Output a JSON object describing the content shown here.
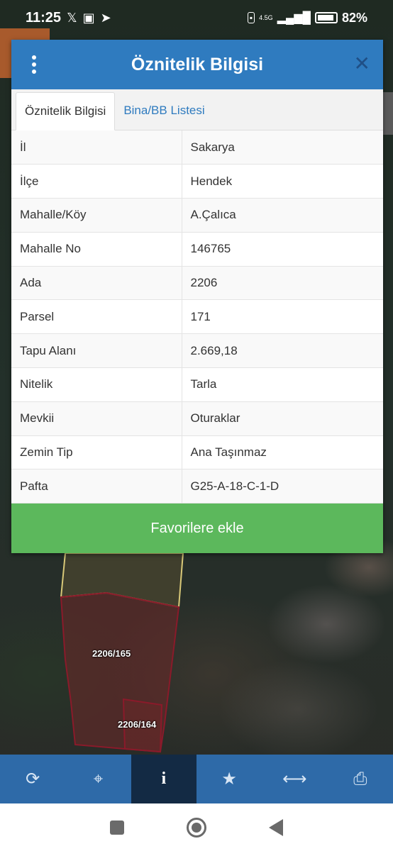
{
  "status_bar": {
    "time": "11:25",
    "left_icons": [
      "x-icon",
      "image-icon",
      "telegram-icon"
    ],
    "network": "4.5G",
    "battery_percent": "82%"
  },
  "dialog": {
    "title": "Öznitelik Bilgisi",
    "tabs": [
      {
        "label": "Öznitelik Bilgisi",
        "active": true
      },
      {
        "label": "Bina/BB Listesi",
        "active": false
      }
    ],
    "rows": [
      {
        "key": "İl",
        "value": "Sakarya"
      },
      {
        "key": "İlçe",
        "value": "Hendek"
      },
      {
        "key": "Mahalle/Köy",
        "value": "A.Çalıca"
      },
      {
        "key": "Mahalle No",
        "value": "146765"
      },
      {
        "key": "Ada",
        "value": "2206"
      },
      {
        "key": "Parsel",
        "value": "171"
      },
      {
        "key": "Tapu Alanı",
        "value": "2.669,18"
      },
      {
        "key": "Nitelik",
        "value": "Tarla"
      },
      {
        "key": "Mevkii",
        "value": "Oturaklar"
      },
      {
        "key": "Zemin Tip",
        "value": "Ana Taşınmaz"
      },
      {
        "key": "Pafta",
        "value": "G25-A-18-C-1-D"
      }
    ],
    "favorite_button": "Favorilere ekle"
  },
  "map": {
    "parcel_labels": [
      "2206/165",
      "2206/164"
    ]
  },
  "toolbar": {
    "items": [
      "refresh-icon",
      "locate-icon",
      "info-icon",
      "star-icon",
      "measure-icon",
      "print-icon"
    ],
    "active": "info-icon"
  },
  "colors": {
    "header_blue": "#2f7bbf",
    "favorite_green": "#5cb85c",
    "toolbar_blue": "#2e6aa8",
    "toolbar_active": "#132a44"
  }
}
